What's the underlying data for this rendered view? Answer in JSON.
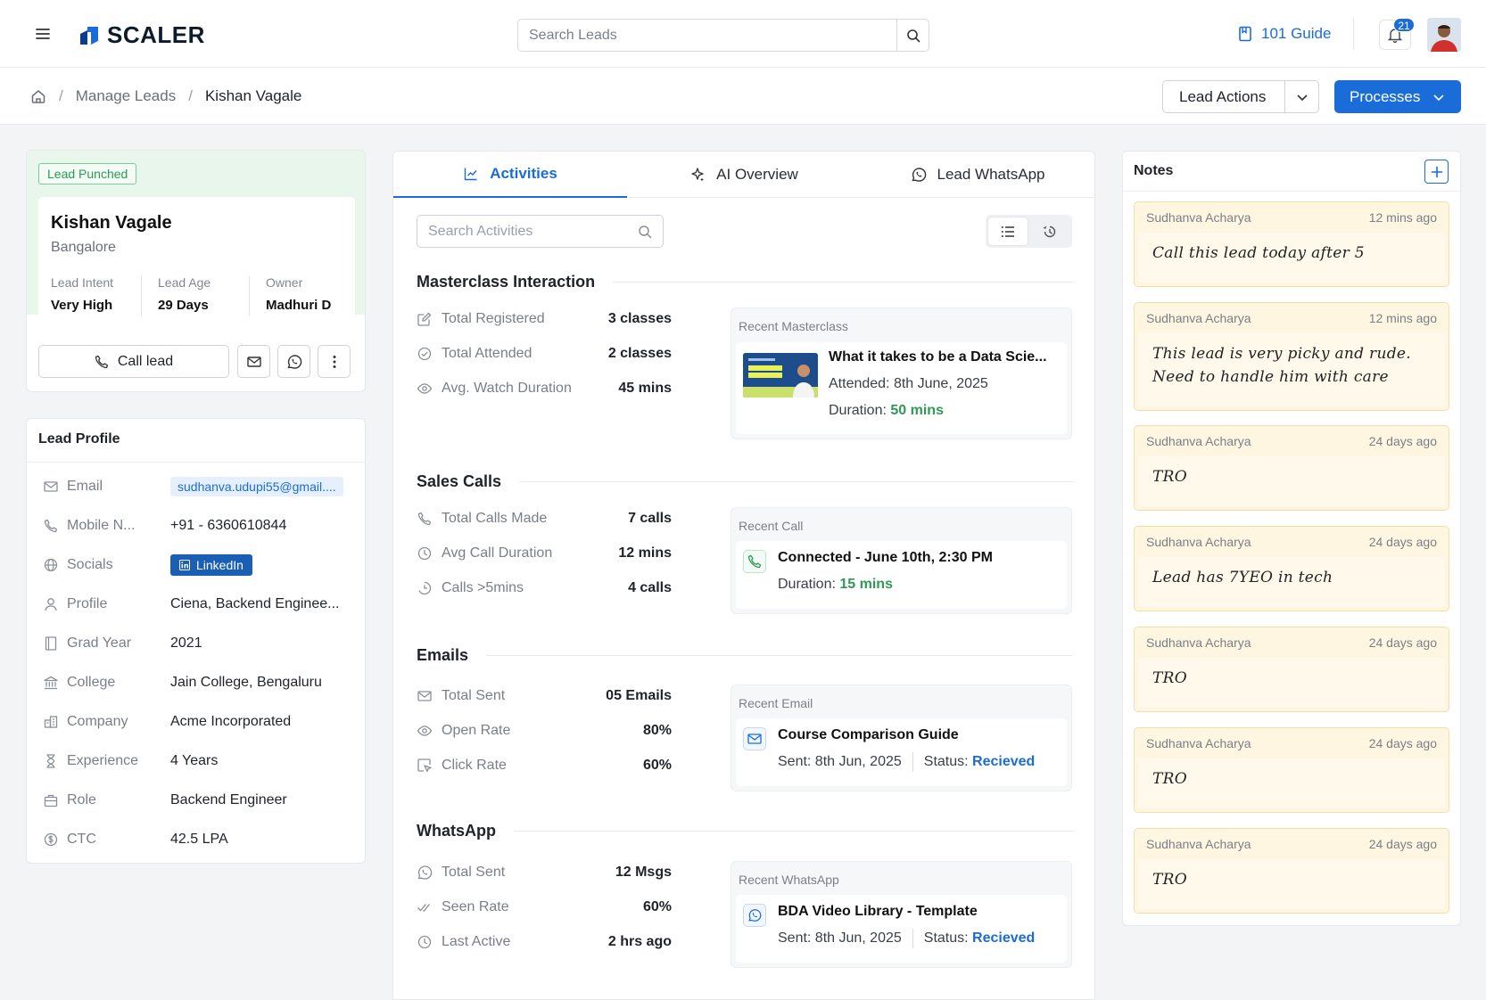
{
  "header": {
    "logo_text": "SCALER",
    "search_placeholder": "Search Leads",
    "guide_label": "101 Guide",
    "notification_count": "21"
  },
  "breadcrumb": {
    "items": [
      "Manage Leads",
      "Kishan Vagale"
    ]
  },
  "actions": {
    "lead_actions_label": "Lead Actions",
    "processes_label": "Processes"
  },
  "lead": {
    "tag": "Lead Punched",
    "name": "Kishan Vagale",
    "city": "Bangalore",
    "stats": [
      {
        "label": "Lead Intent",
        "value": "Very High"
      },
      {
        "label": "Lead Age",
        "value": "29 Days"
      },
      {
        "label": "Owner",
        "value": "Madhuri D"
      }
    ],
    "call_label": "Call lead"
  },
  "profile": {
    "title": "Lead Profile",
    "rows": [
      {
        "label": "Email",
        "value": "sudhanva.udupi55@gmail....",
        "icon": "mail-icon"
      },
      {
        "label": "Mobile N...",
        "value": "+91 - 6360610844",
        "icon": "phone-icon"
      },
      {
        "label": "Socials",
        "value": "LinkedIn",
        "icon": "globe-icon"
      },
      {
        "label": "Profile",
        "value": "Ciena, Backend Enginee...",
        "icon": "user-icon"
      },
      {
        "label": "Grad Year",
        "value": "2021",
        "icon": "book-icon"
      },
      {
        "label": "College",
        "value": "Jain College, Bengaluru",
        "icon": "bank-icon"
      },
      {
        "label": "Company",
        "value": "Acme Incorporated",
        "icon": "building-icon"
      },
      {
        "label": "Experience",
        "value": "4 Years",
        "icon": "hourglass-icon"
      },
      {
        "label": "Role",
        "value": "Backend Engineer",
        "icon": "briefcase-icon"
      },
      {
        "label": "CTC",
        "value": "42.5 LPA",
        "icon": "dollar-icon"
      }
    ]
  },
  "tabs": [
    "Activities",
    "AI Overview",
    "Lead WhatsApp"
  ],
  "activities": {
    "search_placeholder": "Search Activities",
    "sections": [
      {
        "title": "Masterclass Interaction",
        "stats": [
          {
            "label": "Total Registered",
            "value": "3 classes"
          },
          {
            "label": "Total Attended",
            "value": "2 classes"
          },
          {
            "label": "Avg. Watch Duration",
            "value": "45 mins"
          }
        ],
        "recent_label": "Recent Masterclass",
        "recent_title": "What it takes to be a Data Scie...",
        "recent_line1": "Attended: 8th June, 2025",
        "recent_line2_prefix": "Duration: ",
        "recent_line2_value": "50 mins"
      },
      {
        "title": "Sales Calls",
        "stats": [
          {
            "label": "Total Calls Made",
            "value": "7 calls"
          },
          {
            "label": "Avg Call Duration",
            "value": "12 mins"
          },
          {
            "label": "Calls >5mins",
            "value": "4 calls"
          }
        ],
        "recent_label": "Recent Call",
        "recent_title": "Connected - June 10th, 2:30 PM",
        "recent_line2_prefix": "Duration: ",
        "recent_line2_value": "15 mins"
      },
      {
        "title": "Emails",
        "stats": [
          {
            "label": "Total Sent",
            "value": "05 Emails"
          },
          {
            "label": "Open Rate",
            "value": "80%"
          },
          {
            "label": "Click Rate",
            "value": "60%"
          }
        ],
        "recent_label": "Recent Email",
        "recent_title": "Course Comparison Guide",
        "recent_sent": "Sent: 8th Jun, 2025",
        "recent_status_prefix": "Status: ",
        "recent_status_value": "Recieved"
      },
      {
        "title": "WhatsApp",
        "stats": [
          {
            "label": "Total Sent",
            "value": "12 Msgs"
          },
          {
            "label": "Seen Rate",
            "value": "60%"
          },
          {
            "label": "Last Active",
            "value": "2 hrs ago"
          }
        ],
        "recent_label": "Recent WhatsApp",
        "recent_title": "BDA Video Library - Template",
        "recent_sent": "Sent: 8th Jun, 2025",
        "recent_status_prefix": "Status: ",
        "recent_status_value": "Recieved"
      }
    ]
  },
  "notes": {
    "title": "Notes",
    "items": [
      {
        "author": "Sudhanva Acharya",
        "time": "12 mins ago",
        "text": "Call this lead today after 5"
      },
      {
        "author": "Sudhanva Acharya",
        "time": "12 mins ago",
        "text": "This lead is very picky and rude. Need to handle him with care"
      },
      {
        "author": "Sudhanva Acharya",
        "time": "24 days ago",
        "text": "TRO"
      },
      {
        "author": "Sudhanva Acharya",
        "time": "24 days ago",
        "text": "Lead has 7YEO in tech"
      },
      {
        "author": "Sudhanva Acharya",
        "time": "24 days ago",
        "text": "TRO"
      },
      {
        "author": "Sudhanva Acharya",
        "time": "24 days ago",
        "text": "TRO"
      },
      {
        "author": "Sudhanva Acharya",
        "time": "24 days ago",
        "text": "TRO"
      }
    ]
  },
  "colors": {
    "accent": "#1a6cd8",
    "success": "#2e9a55",
    "note_bg": "#fff6e2"
  }
}
